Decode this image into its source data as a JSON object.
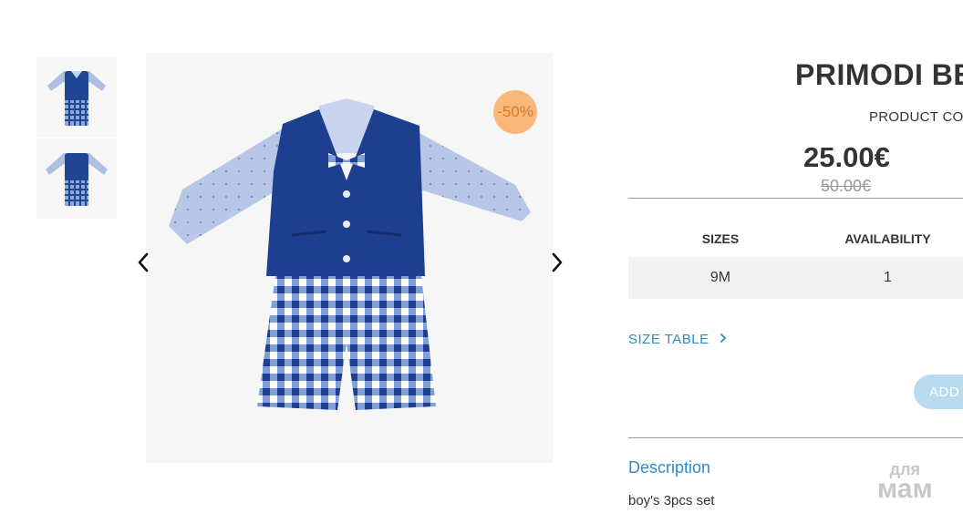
{
  "product": {
    "title": "PRIMODI BE",
    "code_label": "PRODUCT CO",
    "price": "25.00€",
    "old_price": "50.00€",
    "discount_badge": "-50%"
  },
  "gallery": {
    "thumbnails": [
      "thumb-front",
      "thumb-back"
    ],
    "prev_icon": "chevron-left-icon",
    "next_icon": "chevron-right-icon"
  },
  "sizes_table": {
    "headers": [
      "SIZES",
      "AVAILABILITY"
    ],
    "rows": [
      [
        "9M",
        "1"
      ]
    ]
  },
  "size_table_link": "SIZE TABLE",
  "add_button": "ADD",
  "description": {
    "title": "Description",
    "text": "boy's 3pcs set"
  },
  "watermark": {
    "line1": "для",
    "line2": "мам"
  },
  "colors": {
    "accent": "#2a8bc9",
    "badge": "#f9b779",
    "button": "#b9dbf0"
  }
}
